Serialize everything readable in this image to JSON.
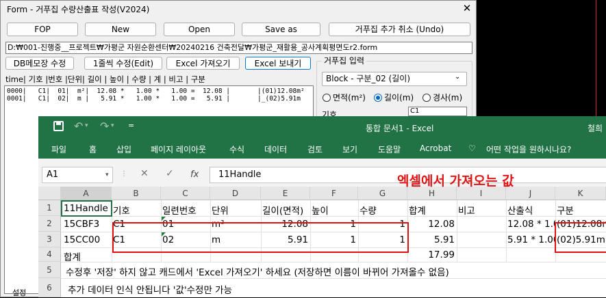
{
  "form": {
    "title": "Form - 거푸집 수량산출표 작성(V2024)",
    "close_glyph": "✕",
    "buttons": {
      "fop": "FOP",
      "new": "New",
      "open": "Open",
      "save_as": "Save as",
      "undo": "거푸집 추가 취소 (Undo)",
      "db_edit": "DB메모장 수정",
      "line_edit": "1줄씩 수정(Edit)",
      "excel_import": "Excel 가져오기",
      "excel_export": "Excel 보내기"
    },
    "path": "D:₩001-진행중__프로젝트₩가평군 자원순환센터₩20240216 건축전달₩가평군_재활용_공사계획평면도r2.form",
    "column_header": "time| 기호 |번호 |단위|  길이  |  높이  |  수량  |  계  | 비고 |  구분",
    "data_lines": [
      "0000|   C1|  01|  m²|  12.08 *   1.00 *   1.00 =  12.08 |       |(01)12.08m²",
      "0001|   C1|  02|  m |   5.91 *   1.00 *   1.00 =   5.91 |       |_(02)5.91m"
    ],
    "input_group": {
      "title": "거푸집 입력",
      "dropdown_value": "Block - 구분_02 (길이)",
      "radios": [
        "면적(m²)",
        "길이(m)",
        "경사(m)"
      ],
      "selected": "길이(m)",
      "kiho_label": "기호",
      "kiho_value": "C1"
    },
    "bottom_tab": "설정"
  },
  "excel": {
    "title": "통합 문서1 - Excel",
    "user": "철희",
    "qat": {
      "save": "save-icon",
      "undo": "undo-icon",
      "redo": "redo-icon",
      "customize": "customize-icon"
    },
    "menu": [
      "파일",
      "홈",
      "삽입",
      "페이지 레이아웃",
      "수식",
      "데이터",
      "검토",
      "보기",
      "도움말",
      "Acrobat"
    ],
    "tellme": "어떤 작업을 원하시나요?",
    "name_box": "A1",
    "formula": "11Handle",
    "fx": "fx",
    "annotation": "엑셀에서 가져오는 값",
    "columns": [
      "A",
      "B",
      "C",
      "D",
      "E",
      "F",
      "G",
      "H",
      "I",
      "J",
      "K"
    ],
    "row_numbers": [
      "1",
      "2",
      "3",
      "4",
      "5",
      "6"
    ],
    "rows": [
      [
        "11Handle",
        "기호",
        "일련번호",
        "단위",
        "길이(면적)",
        "높이",
        "수량",
        "합계",
        "비고",
        "산출식",
        "구분"
      ],
      [
        "15CBF3",
        "C1",
        "01",
        "m²",
        "12.08",
        "1",
        "1",
        "12.08",
        "",
        "12.08 * 1.0",
        "(01)12.08m"
      ],
      [
        "15CC00",
        "C1",
        "02",
        "m",
        "5.91",
        "1",
        "1",
        "5.91",
        "",
        "5.91 * 1.00",
        "(02)5.91m"
      ],
      [
        "합계",
        "",
        "",
        "",
        "",
        "",
        "",
        "17.99",
        "",
        "",
        ""
      ]
    ],
    "note1": "수정후 '저장' 하지 않고 캐드에서 'Excel 가져오기' 하세요 (저장하면 이름이 바뀌어 가져올수 없음)",
    "note2": "추가 데이터 인식 안됩니다 '값'수정만 가능"
  }
}
